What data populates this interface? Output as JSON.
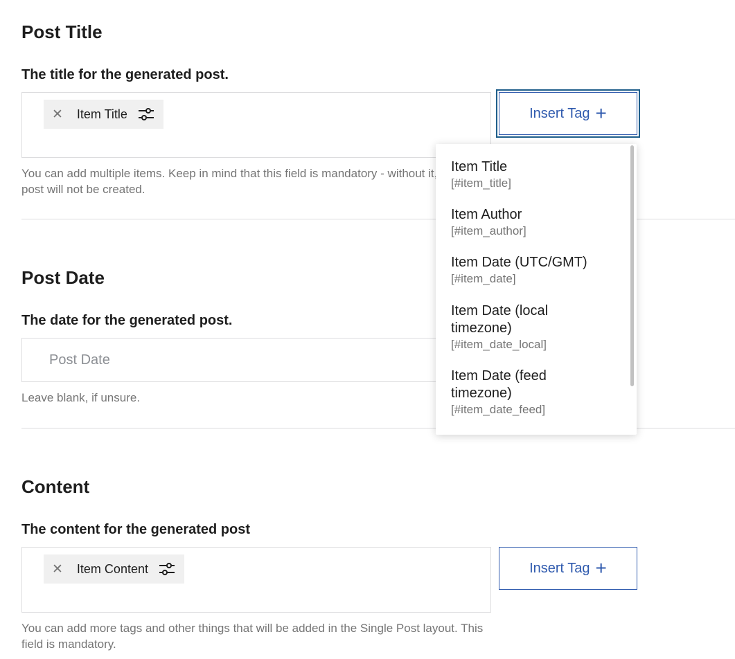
{
  "post_title": {
    "heading": "Post Title",
    "label": "The title for the generated post.",
    "chips": [
      {
        "label": "Item Title"
      }
    ],
    "insert_tag_label": "Insert Tag",
    "help": "You can add multiple items. Keep in mind that this field is mandatory - without it, a post will not be created."
  },
  "post_date": {
    "heading": "Post Date",
    "label": "The date for the generated post.",
    "placeholder": "Post Date",
    "help": "Leave blank, if unsure."
  },
  "content": {
    "heading": "Content",
    "label": "The content for the generated post",
    "chips": [
      {
        "label": "Item Content"
      }
    ],
    "insert_tag_label": "Insert Tag",
    "help": "You can add more tags and other things that will be added in the Single Post layout. This field is mandatory."
  },
  "tag_dropdown": {
    "items": [
      {
        "name": "Item Title",
        "code": "[#item_title]"
      },
      {
        "name": "Item Author",
        "code": "[#item_author]"
      },
      {
        "name": "Item Date (UTC/GMT)",
        "code": "[#item_date]"
      },
      {
        "name": "Item Date (local timezone)",
        "code": "[#item_date_local]"
      },
      {
        "name": "Item Date (feed timezone)",
        "code": "[#item_date_feed]"
      }
    ]
  },
  "icons": {
    "remove": "close-icon",
    "settings": "sliders-icon",
    "add": "plus-icon"
  },
  "colors": {
    "accent": "#2f5aae",
    "focus_ring": "#1f5f8b",
    "muted_text": "#757575",
    "chip_bg": "#f0f0f0",
    "border": "#dcdcde"
  }
}
